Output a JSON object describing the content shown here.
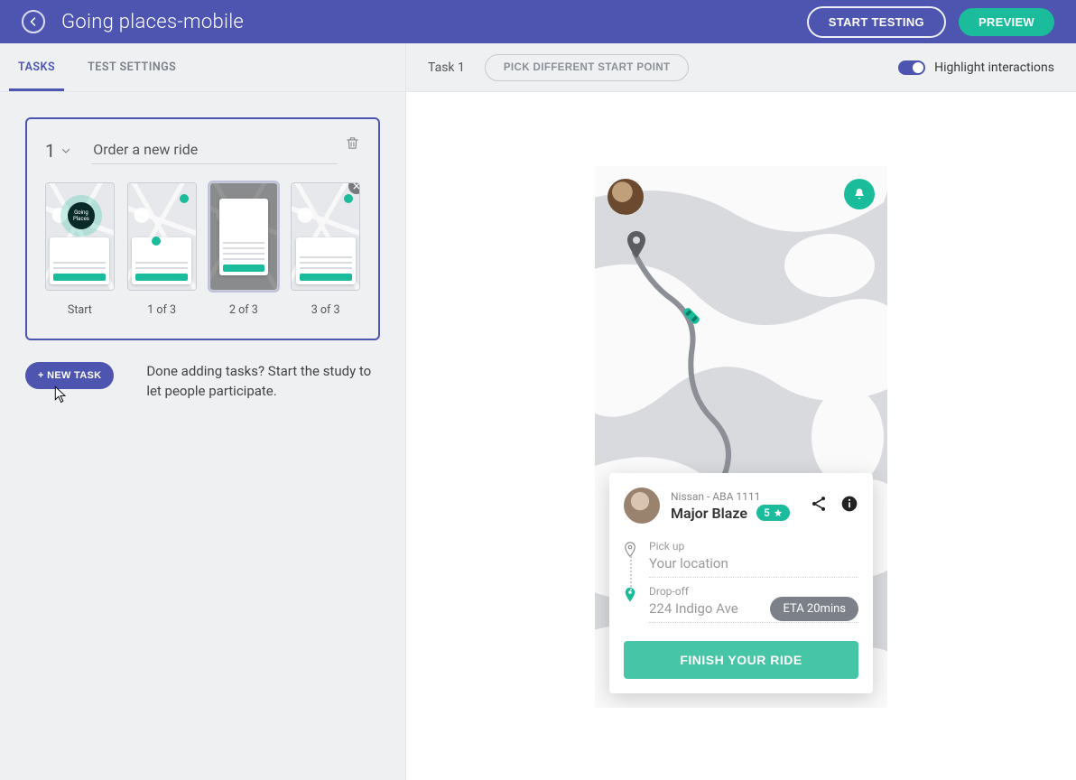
{
  "header": {
    "title": "Going places-mobile",
    "start_testing": "START TESTING",
    "preview": "PREVIEW"
  },
  "tabs": {
    "tasks": "TASKS",
    "test_settings": "TEST SETTINGS"
  },
  "task_bar": {
    "label": "Task 1",
    "pick_different": "PICK DIFFERENT START POINT",
    "highlight_label": "Highlight interactions"
  },
  "task": {
    "number": "1",
    "title": "Order a new ride",
    "thumbs": [
      {
        "caption": "Start",
        "badge": "Going Places"
      },
      {
        "caption": "1 of 3"
      },
      {
        "caption": "2 of 3"
      },
      {
        "caption": "3 of 3"
      }
    ]
  },
  "new_task": {
    "button": "+ NEW TASK",
    "hint": "Done adding tasks? Start the study to let people participate."
  },
  "ride": {
    "car": "Nissan - ABA 1111",
    "driver": "Major Blaze",
    "rating": "5",
    "pickup_label": "Pick up",
    "pickup_value": "Your location",
    "dropoff_label": "Drop-off",
    "dropoff_value": "224 Indigo Ave",
    "eta": "ETA 20mins",
    "finish": "FINISH YOUR RIDE"
  }
}
